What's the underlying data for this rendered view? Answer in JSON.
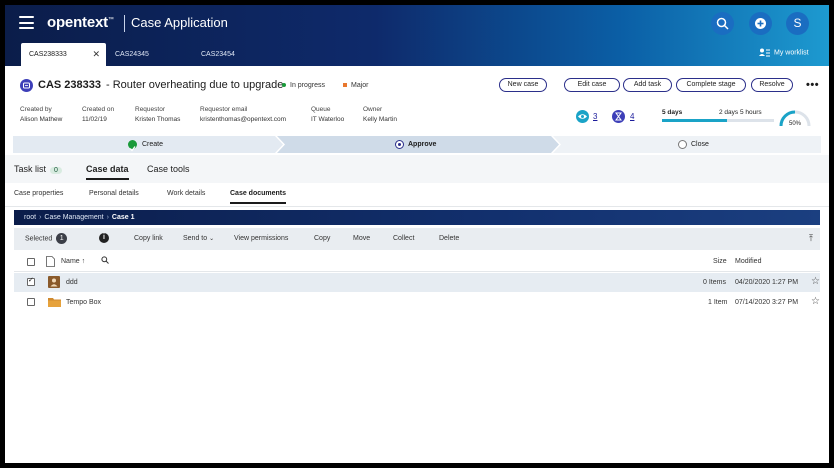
{
  "header": {
    "brand": "opentext",
    "brand_tm": "™",
    "app_title": "Case Application",
    "avatar_initial": "S",
    "worklist_label": "My worklist",
    "tabs": [
      {
        "label": "CAS238333",
        "active": true
      },
      {
        "label": "CAS24345",
        "active": false
      },
      {
        "label": "CAS23454",
        "active": false
      }
    ]
  },
  "case": {
    "id": "CAS 238333",
    "title": " - Router overheating due to upgrade",
    "status": "In progress",
    "priority": "Major",
    "status_color": "#1a9a3a",
    "priority_color": "#e8772e",
    "actions": [
      "New case",
      "Edit case",
      "Add task",
      "Complete stage",
      "Resolve"
    ],
    "meta": [
      {
        "label": "Created by",
        "value": "Alison Mathew"
      },
      {
        "label": "Created on",
        "value": "11/02/19"
      },
      {
        "label": "Requestor",
        "value": "Kristen Thomas"
      },
      {
        "label": "Requestor email",
        "value": "kristenthomas@opentext.com"
      },
      {
        "label": "Queue",
        "value": "IT Waterloo"
      },
      {
        "label": "Owner",
        "value": "Kelly Martin"
      }
    ],
    "watchers": "3",
    "tasks": "4",
    "sla_days": "5 days",
    "sla_remaining": "2 days 5 hours",
    "sla_progress_pct": 58,
    "completion": "50%",
    "completion_pct": 50
  },
  "stepper": [
    {
      "label": "Create",
      "state": "done"
    },
    {
      "label": "Approve",
      "state": "current"
    },
    {
      "label": "Close",
      "state": "pending"
    }
  ],
  "main_tabs": {
    "task_list": "Task list",
    "task_count": "0",
    "case_data": "Case data",
    "case_tools": "Case tools"
  },
  "sub_tabs": [
    "Case properties",
    "Personal details",
    "Work details",
    "Case documents"
  ],
  "documents": {
    "breadcrumb": [
      "root",
      "Case Management",
      "Case 1"
    ],
    "selected_label": "Selected",
    "selected_count": "1",
    "toolbar": [
      "Copy link",
      "Send to",
      "View permissions",
      "Copy",
      "Move",
      "Collect",
      "Delete"
    ],
    "columns": {
      "name": "Name",
      "size": "Size",
      "modified": "Modified"
    },
    "rows": [
      {
        "name": "ddd",
        "size": "0 Items",
        "modified": "04/20/2020 1:27 PM",
        "selected": true
      },
      {
        "name": "Tempo Box",
        "size": "1 Item",
        "modified": "07/14/2020 3:27 PM",
        "selected": false
      }
    ]
  }
}
